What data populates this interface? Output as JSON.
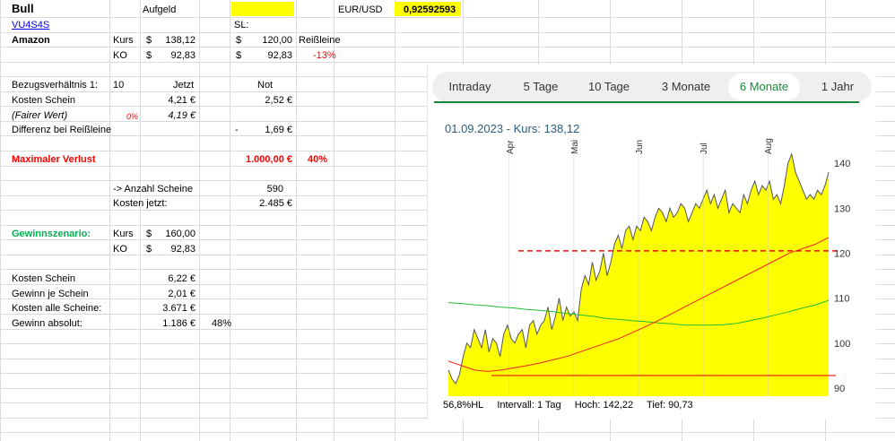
{
  "sheet": {
    "title": "Bull",
    "aufgeld_label": "Aufgeld",
    "fx_label": "EUR/USD",
    "fx_value": "0,92592593",
    "ticker_link": "VU4S4S",
    "sl_label": "SL:",
    "company": "Amazon",
    "kurs_label": "Kurs",
    "ko_label": "KO",
    "currency": "$",
    "kurs_value": "138,12",
    "ko_value": "92,83",
    "sl_kurs_value": "120,00",
    "sl_ko_value": "92,83",
    "reissleine_label": "Reißleine",
    "reissleine_pct": "-13%",
    "bezug_label": "Bezugsverhältnis 1:",
    "bezug_value": "10",
    "jetzt_label": "Jetzt",
    "not_label": "Not",
    "kosten_schein_label": "Kosten Schein",
    "kosten_schein_jetzt": "4,21 €",
    "kosten_schein_not": "2,52 €",
    "fairer_wert_label": "(Fairer Wert)",
    "fairer_wert_pct": "0%",
    "fairer_wert_value": "4,19 €",
    "differenz_label": "Differenz bei Reißleine",
    "differenz_sign": "-",
    "differenz_value": "1,69 €",
    "max_verlust_label": "Maximaler Verlust",
    "max_verlust_value": "1.000,00 €",
    "max_verlust_pct": "40%",
    "anzahl_label": "-> Anzahl Scheine",
    "anzahl_value": "590",
    "kosten_jetzt_label": "Kosten jetzt:",
    "kosten_jetzt_value": "2.485 €",
    "gewinnszenario_label": "Gewinnszenario:",
    "gs_kurs_value": "160,00",
    "gs_ko_value": "92,83",
    "gs_kosten_schein_label": "Kosten Schein",
    "gs_kosten_schein_value": "6,22 €",
    "gewinn_je_label": "Gewinn je Schein",
    "gewinn_je_value": "2,01 €",
    "kosten_alle_label": "Kosten alle Scheine:",
    "kosten_alle_value": "3.671 €",
    "gewinn_abs_label": "Gewinn absolut:",
    "gewinn_abs_value": "1.186 €",
    "gewinn_abs_pct": "48%"
  },
  "chart": {
    "tabs": [
      "Intraday",
      "5 Tage",
      "10 Tage",
      "3 Monate",
      "6 Monate",
      "1 Jahr"
    ],
    "active_tab": "6 Monate",
    "title": "01.09.2023  -  Kurs: 138,12",
    "footer": {
      "hl": "56,8%HL",
      "intervall": "Intervall: 1 Tag",
      "hoch": "Hoch:  142,22",
      "tief": "Tief:   90,73"
    },
    "colors": {
      "area_fill": "#ffff00",
      "price_line": "#555555",
      "ma_green": "#22bb33",
      "ma_red": "#ee2222",
      "dashed_line": "#ee1111",
      "ko_line": "#ee1111",
      "active_tab": "#1a8a3a"
    }
  },
  "chart_data": {
    "type": "area",
    "title": "01.09.2023  -  Kurs: 138,12",
    "x_ticks": [
      "Apr",
      "Mai",
      "Jun",
      "Jul",
      "Aug"
    ],
    "y_ticks": [
      90,
      100,
      110,
      120,
      130,
      140
    ],
    "ylim": [
      88,
      144
    ],
    "series": [
      {
        "values": [
          94,
          92,
          91,
          93,
          97,
          100,
          99,
          103,
          101,
          99,
          103,
          98,
          101,
          100,
          97,
          102,
          104,
          101,
          100,
          102,
          103,
          99,
          104,
          105,
          102,
          104,
          105,
          108,
          103,
          106,
          110,
          105,
          108,
          106,
          107,
          105,
          112,
          115,
          113,
          118,
          114,
          116,
          120,
          115,
          118,
          122,
          124,
          121,
          125,
          126,
          123,
          126,
          125,
          128,
          127,
          125,
          128,
          130,
          129,
          127,
          130,
          128,
          129,
          131,
          130,
          127,
          129,
          131,
          130,
          132,
          134,
          131,
          133,
          130,
          132,
          134,
          129,
          131,
          130,
          129,
          133,
          131,
          134,
          136,
          133,
          135,
          134,
          136,
          132,
          133,
          131,
          135,
          140,
          142,
          138,
          136,
          134,
          132,
          133,
          132,
          134,
          133,
          135,
          138
        ]
      },
      {
        "values": [
          109,
          108.8,
          108.5,
          108.3,
          108,
          107.8,
          107.5,
          107.3,
          107,
          106.6,
          106.3,
          106,
          105.5,
          105.3,
          105,
          104.8,
          104.5,
          104.3,
          104,
          104,
          104,
          104.1,
          104.4,
          105,
          105.6,
          106.3,
          107,
          107.8,
          108.5,
          109.5
        ]
      },
      {
        "values": [
          96,
          95,
          94,
          93.7,
          94,
          94.5,
          95,
          95.6,
          96.3,
          97,
          98,
          99,
          100,
          101,
          102.3,
          103.6,
          105,
          106.5,
          108,
          109.5,
          111,
          112.5,
          114,
          115.5,
          117,
          118.5,
          120,
          121,
          122,
          123.5
        ]
      }
    ],
    "reference_lines": [
      {
        "y": 120.5,
        "style": "dashed"
      },
      {
        "y": 92.8,
        "style": "solid"
      }
    ]
  }
}
